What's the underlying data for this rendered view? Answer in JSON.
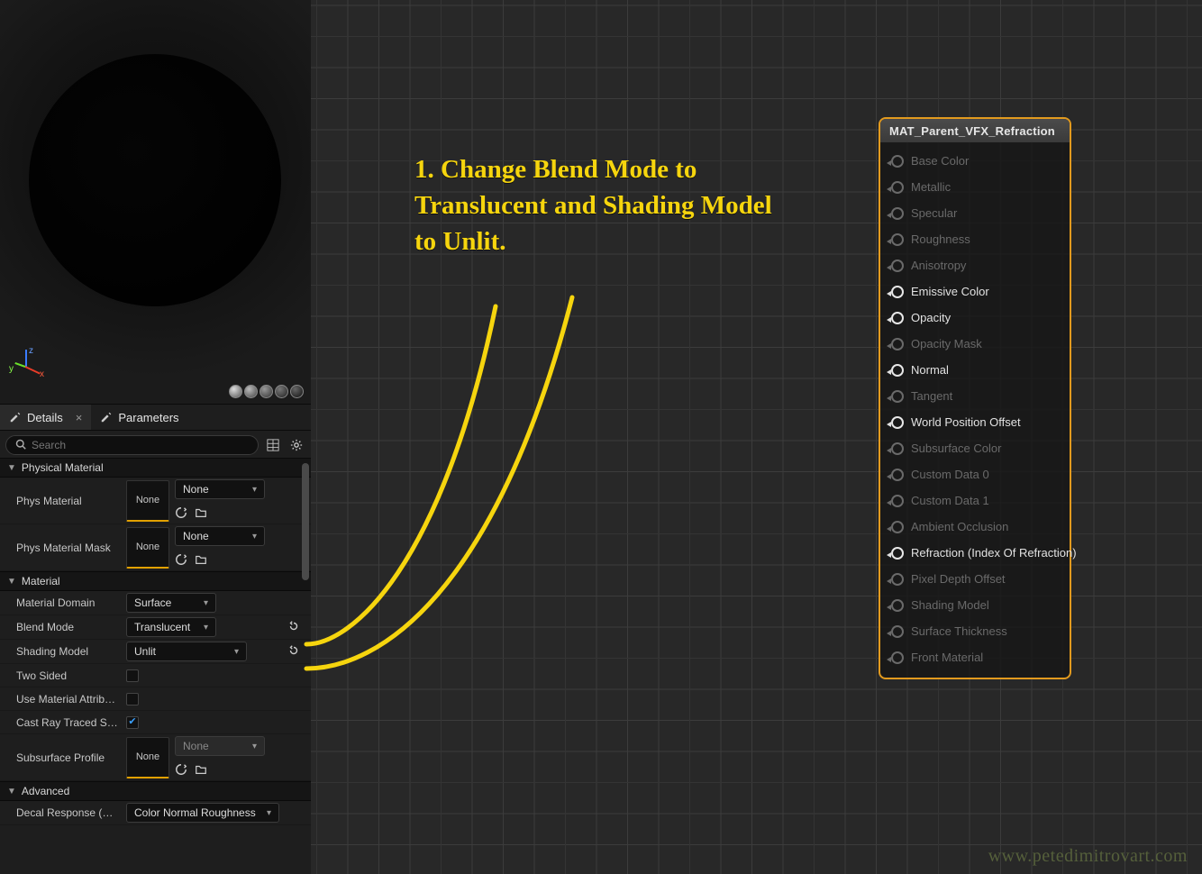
{
  "tabs": {
    "details": "Details",
    "parameters": "Parameters"
  },
  "search": {
    "placeholder": "Search"
  },
  "sections": {
    "physical_material": "Physical Material",
    "material": "Material",
    "advanced": "Advanced"
  },
  "details": {
    "phys_material": {
      "label": "Phys Material",
      "slot": "None",
      "dropdown": "None"
    },
    "phys_material_mask": {
      "label": "Phys Material Mask",
      "slot": "None",
      "dropdown": "None"
    },
    "material_domain": {
      "label": "Material Domain",
      "value": "Surface"
    },
    "blend_mode": {
      "label": "Blend Mode",
      "value": "Translucent"
    },
    "shading_model": {
      "label": "Shading Model",
      "value": "Unlit"
    },
    "two_sided": {
      "label": "Two Sided",
      "checked": false
    },
    "use_material_attrs": {
      "label": "Use Material Attribut…",
      "checked": false
    },
    "cast_ray_traced": {
      "label": "Cast Ray Traced Sha…",
      "checked": true
    },
    "subsurface_profile": {
      "label": "Subsurface Profile",
      "slot": "None",
      "dropdown": "None"
    },
    "decal_response": {
      "label": "Decal Response (DB…",
      "value": "Color Normal Roughness"
    }
  },
  "material_node": {
    "title": "MAT_Parent_VFX_Refraction",
    "pins": [
      {
        "label": "Base Color",
        "active": false
      },
      {
        "label": "Metallic",
        "active": false
      },
      {
        "label": "Specular",
        "active": false
      },
      {
        "label": "Roughness",
        "active": false
      },
      {
        "label": "Anisotropy",
        "active": false
      },
      {
        "label": "Emissive Color",
        "active": true
      },
      {
        "label": "Opacity",
        "active": true
      },
      {
        "label": "Opacity Mask",
        "active": false
      },
      {
        "label": "Normal",
        "active": true
      },
      {
        "label": "Tangent",
        "active": false
      },
      {
        "label": "World Position Offset",
        "active": true
      },
      {
        "label": "Subsurface Color",
        "active": false
      },
      {
        "label": "Custom Data 0",
        "active": false
      },
      {
        "label": "Custom Data 1",
        "active": false
      },
      {
        "label": "Ambient Occlusion",
        "active": false
      },
      {
        "label": "Refraction (Index Of Refraction)",
        "active": true
      },
      {
        "label": "Pixel Depth Offset",
        "active": false
      },
      {
        "label": "Shading Model",
        "active": false
      },
      {
        "label": "Surface Thickness",
        "active": false
      },
      {
        "label": "Front Material",
        "active": false
      }
    ]
  },
  "annotation": "1. Change Blend Mode to Translucent and Shading Model to Unlit.",
  "watermark": "www.petedimitrovart.com"
}
